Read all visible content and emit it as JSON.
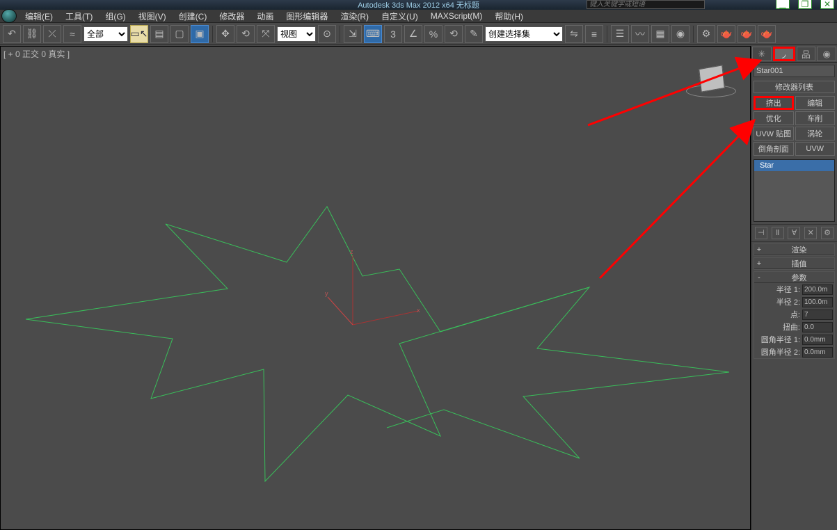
{
  "app": {
    "title": "Autodesk 3ds Max  2012 x64   无标题",
    "search_placeholder": "键入关键字或短语"
  },
  "menu": {
    "items": [
      "编辑(E)",
      "工具(T)",
      "组(G)",
      "视图(V)",
      "创建(C)",
      "修改器",
      "动画",
      "图形编辑器",
      "渲染(R)",
      "自定义(U)",
      "MAXScript(M)",
      "帮助(H)"
    ]
  },
  "toolbar": {
    "filter_sel": "全部",
    "view_sel": "视图",
    "named_sel": "创建选择集"
  },
  "viewport": {
    "label": "[ + 0 正交 0 真实 ]",
    "axis": {
      "x": "x",
      "y": "y",
      "z": "z"
    }
  },
  "panel": {
    "object_name": "Star001",
    "modlist_label": "修改器列表",
    "mod_buttons": [
      "挤出",
      "编辑",
      "优化",
      "车削",
      "UVW 贴图",
      "涡轮",
      "倒角剖面",
      "UVW"
    ],
    "stack_item": "Star",
    "rollouts": {
      "render": "渲染",
      "interp": "插值",
      "params": "参数"
    },
    "params": {
      "radius1_label": "半径 1:",
      "radius1_val": "200.0m",
      "radius2_label": "半径 2:",
      "radius2_val": "100.0m",
      "points_label": "点:",
      "points_val": "7",
      "distort_label": "扭曲:",
      "distort_val": "0.0",
      "fillet1_label": "圆角半径 1:",
      "fillet1_val": "0.0mm",
      "fillet2_label": "圆角半径 2:",
      "fillet2_val": "0.0mm"
    }
  }
}
